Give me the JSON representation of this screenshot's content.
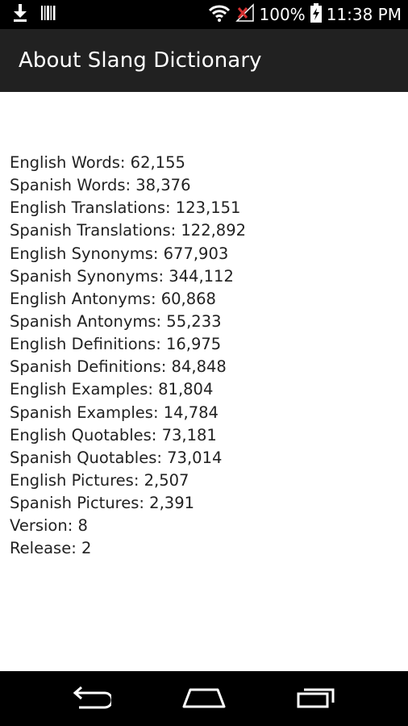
{
  "status_bar": {
    "battery": "100%",
    "time": "11:38 PM",
    "icons": [
      "download-icon",
      "barcode-icon",
      "wifi-icon",
      "no-signal-icon",
      "battery-charging-icon"
    ]
  },
  "action_bar": {
    "title": "About Slang Dictionary"
  },
  "stats": [
    "English Words: 62,155",
    "Spanish Words: 38,376",
    "English Translations: 123,151",
    "Spanish Translations: 122,892",
    "English Synonyms: 677,903",
    "Spanish Synonyms: 344,112",
    "English Antonyms: 60,868",
    "Spanish Antonyms: 55,233",
    "English Definitions: 16,975",
    "Spanish Definitions: 84,848",
    "English Examples: 81,804",
    "Spanish Examples: 14,784",
    "English Quotables: 73,181",
    "Spanish Quotables: 73,014",
    "English Pictures: 2,507",
    "Spanish Pictures: 2,391",
    "Version: 8",
    "Release: 2"
  ],
  "nav_bar": {
    "icons": [
      "back-icon",
      "home-icon",
      "recent-apps-icon"
    ]
  },
  "colors": {
    "status_bar": "#000000",
    "action_bar": "#212121",
    "background": "#ffffff",
    "text": "#222222"
  }
}
